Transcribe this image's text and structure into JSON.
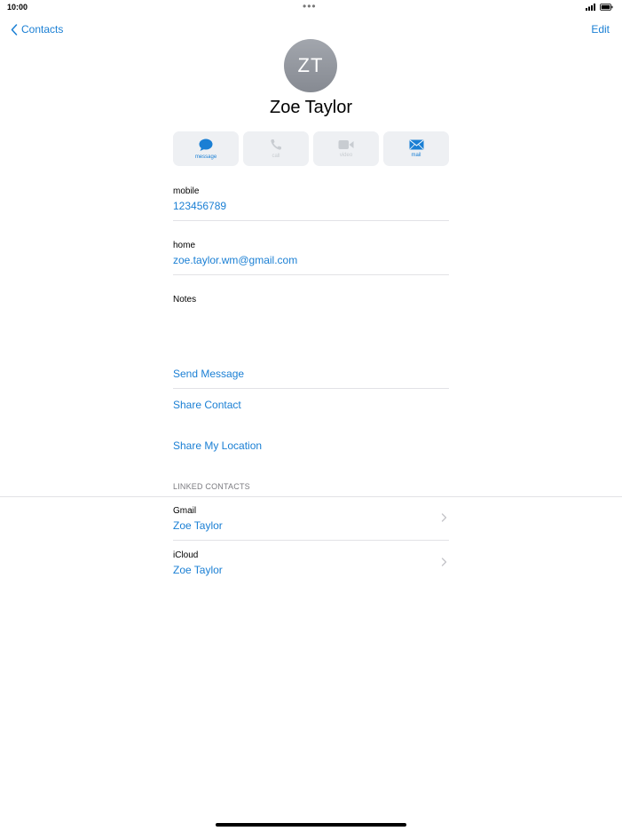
{
  "status_bar": {
    "time": "10:00",
    "dots": "•••"
  },
  "nav": {
    "back_label": "Contacts",
    "edit_label": "Edit"
  },
  "contact": {
    "initials": "ZT",
    "name": "Zoe Taylor"
  },
  "actions": [
    {
      "label": "message",
      "icon": "message-bubble-icon",
      "enabled": true
    },
    {
      "label": "call",
      "icon": "phone-icon",
      "enabled": false
    },
    {
      "label": "video",
      "icon": "video-camera-icon",
      "enabled": false
    },
    {
      "label": "mail",
      "icon": "envelope-icon",
      "enabled": true
    }
  ],
  "fields": {
    "mobile": {
      "label": "mobile",
      "value": "123456789"
    },
    "home": {
      "label": "home",
      "value": "zoe.taylor.wm@gmail.com"
    },
    "notes": {
      "label": "Notes"
    }
  },
  "links": {
    "send_message": "Send Message",
    "share_contact": "Share Contact",
    "share_location": "Share My Location"
  },
  "linked_contacts": {
    "header": "LINKED CONTACTS",
    "items": [
      {
        "source": "Gmail",
        "name": "Zoe Taylor"
      },
      {
        "source": "iCloud",
        "name": "Zoe Taylor"
      }
    ]
  },
  "colors": {
    "accent": "#1a7fd4",
    "disabled": "#c8ccd1",
    "avatar": "#959aa1"
  }
}
